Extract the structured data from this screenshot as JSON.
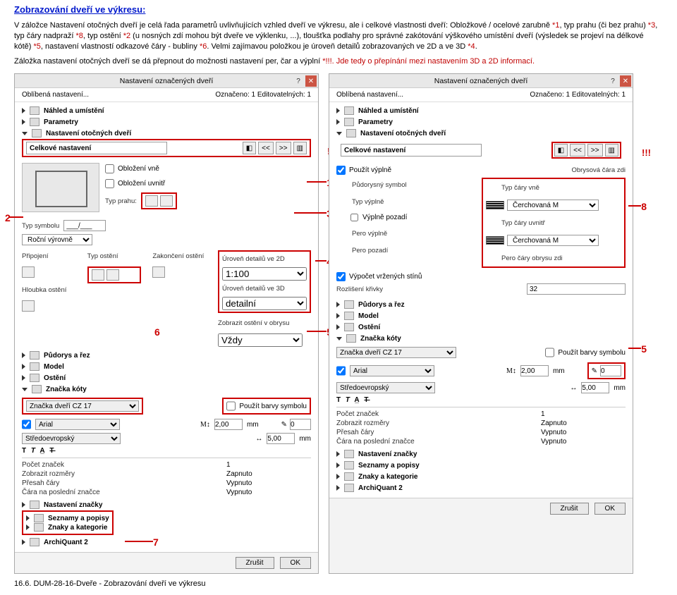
{
  "title": "Zobrazování dveří ve výkresu:",
  "para1": "V záložce Nastavení otočných dveří je celá řada parametrů uvlivňujících vzhled dveří ve výkresu, ale i celkové vlastnosti dveří: Obložkové / ocelové zarubně ",
  "sp1": "*1",
  "para1b": ", typ prahu (či bez prahu) ",
  "sp3": "*3",
  "para1c": ", typ čáry nadpraží ",
  "sp8": "*8",
  "para1d": ", typ ostění ",
  "sp2": "*2",
  "para1e": " (u nosných zdí mohou být dveře ve výklenku, ...), tloušťka podlahy pro správné zakótování výškového umístění dveří (výsledek se projeví na délkové kótě) ",
  "sp5": "*5",
  "para1f": ", nastavení vlastností odkazové čáry - bubliny ",
  "sp6": "*6",
  "para1g": ". Velmi zajímavou položkou je úroveň detailů zobrazovaných ve 2D a ve 3D ",
  "sp4": "*4",
  "para1h": ".",
  "para2a": "Záložka nastavení otočných dveří se dá přepnout do možnosti nastavení per, čar a výplní ",
  "para2b": "*!!!. Jde tedy o přepínání mezi nastavením 3D a 2D informací.",
  "dlg": {
    "title": "Nastavení označených dveří",
    "topLeft": "Oblíbená nastavení...",
    "topRight": "Označeno: 1 Editovatelných: 1",
    "s1": "Náhled a umístění",
    "s2": "Parametry",
    "s3": "Nastavení otočných dveří",
    "celkove": "Celkové nastavení",
    "btn_ll": "<<",
    "btn_rr": ">>",
    "chk1": "Obložení vně",
    "chk2": "Obložení uvnitř",
    "typsymbolu": "Typ symbolu",
    "typsymbolu_v": "___/___",
    "rocni": "Roční výrovně",
    "typprahu": "Typ prahu:",
    "pripojeni": "Připojení",
    "typosteni": "Typ ostění",
    "zakonceni": "Zakončení ostění",
    "urovni2d": "Úroveň detailů ve 2D",
    "urovni2d_v": "1:100",
    "urovni3d": "Úroveň detailů ve 3D",
    "urovni3d_v": "detailní",
    "zobrazit_ost": "Zobrazit ostění v obrysu",
    "zobrazit_ost_v": "Vždy",
    "hloubka": "Hloubka ostění",
    "sec_pudorys": "Půdorys a řez",
    "sec_model": "Model",
    "sec_osteni": "Ostění",
    "sec_znacka": "Značka kóty",
    "znacka_name": "Značka dveří CZ 17",
    "pouzit_barvy": "Použít barvy symbolu",
    "font": "Arial",
    "m_val": "2,00",
    "mm": "mm",
    "stred": "Středoevropský",
    "mm_v2": "5,00",
    "pocet": "Počet značek",
    "pocet_v": "1",
    "zobr_roz": "Zobrazit rozměry",
    "zobr_roz_v": "Zapnuto",
    "presah": "Přesah čáry",
    "presah_v": "Vypnuto",
    "cara_posl": "Čára na poslední značce",
    "cara_posl_v": "Vypnuto",
    "sec_nastznacky": "Nastavení značky",
    "sec_sezn": "Seznamy a popisy",
    "sec_znakykat": "Znaky a kategorie",
    "sec_archi": "ArchiQuant 2",
    "cancel": "Zrušit",
    "ok": "OK",
    "pen_val": "0"
  },
  "dlg2": {
    "pouzit_vyplne": "Použít výplně",
    "obrys_cara": "Obrysová čára zdi",
    "pudorys_symbol": "Půdorysný symbol",
    "typ_vyplne": "Typ výplně",
    "vyplne_pozadi": "Výplně pozadí",
    "pero_vyplne": "Pero výplně",
    "pero_pozadi": "Pero pozadí",
    "vypocet_stinu": "Výpočet vržených stínů",
    "rozliseni_kr": "Rozlišení křivky",
    "rozliseni_v": "32",
    "cary_vne": "Typ čáry vně",
    "cerchM": "Čerchovaná M",
    "cary_uvnitr": "Typ čáry uvnitř",
    "cerchM2": "Čerchovaná M",
    "pero_obrys": "Pero čáry obrysu zdi"
  },
  "callouts": {
    "c1": "1",
    "c2": "2",
    "c3": "3",
    "c4": "4",
    "c5": "5",
    "c6": "6",
    "c7": "7",
    "c8": "8",
    "ex": "!!!"
  },
  "footer": "16.6. DUM-28-16-Dveře - Zobrazování dveří ve výkresu"
}
